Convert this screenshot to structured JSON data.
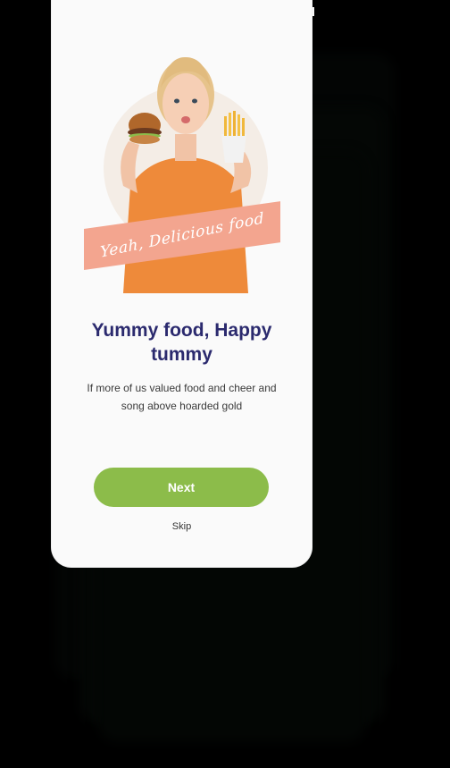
{
  "onboarding": {
    "banner_text": "Yeah, Delicious food",
    "title": "Yummy food, Happy tummy",
    "subtitle": "If more of us valued food and cheer and song above hoarded gold",
    "next_label": "Next",
    "skip_label": "Skip"
  },
  "colors": {
    "title": "#2b2a6e",
    "button": "#8cbc4a",
    "banner": "#f3a58f",
    "card_background": "#fafafa",
    "page_background": "#000000"
  },
  "hero_image": {
    "icon": "woman-eating-burger-and-fries-illustration"
  }
}
